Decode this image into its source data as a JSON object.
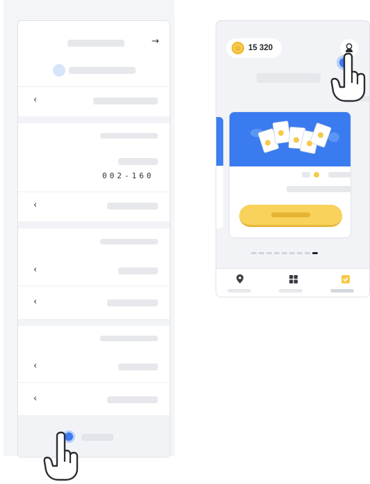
{
  "settings_screen": {
    "back_arrow": "→",
    "chevron": "‹",
    "code": "002-160",
    "rows": [
      {
        "icon": "chevron-left-icon"
      },
      {
        "icon": "chevron-left-icon"
      },
      {
        "icon": "chevron-left-icon"
      },
      {
        "icon": "chevron-left-icon"
      },
      {
        "icon": "chevron-left-icon"
      },
      {
        "icon": "chevron-left-icon"
      }
    ]
  },
  "home_screen": {
    "coins": "15 320",
    "pagination": {
      "total": 9,
      "active_index": 8
    },
    "tabs": [
      {
        "icon": "map-pin-icon"
      },
      {
        "icon": "grid-icon"
      },
      {
        "icon": "clipboard-check-icon",
        "active": true
      }
    ]
  },
  "colors": {
    "accent_blue": "#3a7bf0",
    "coin_yellow": "#f7c948",
    "play_yellow": "#f8d25a",
    "placeholder_gray": "#e6e8ec",
    "tap_indicator": "#3a7bf0"
  }
}
